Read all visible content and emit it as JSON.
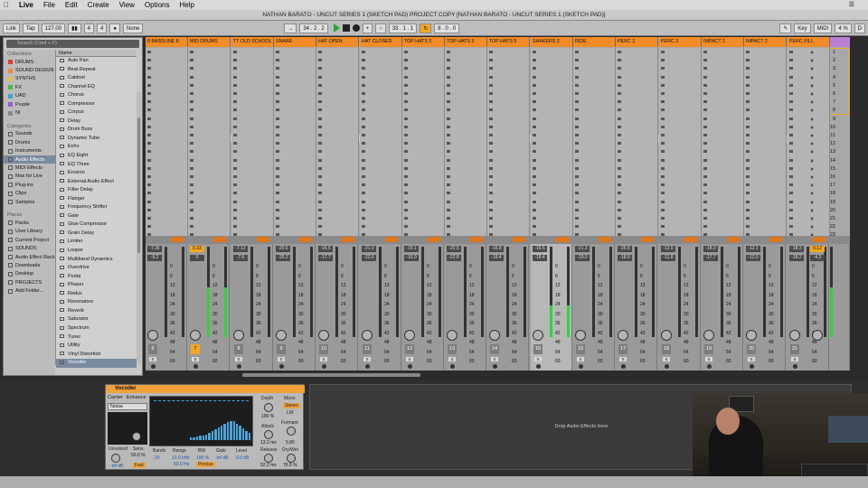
{
  "menubar": {
    "app": "Live",
    "items": [
      "File",
      "Edit",
      "Create",
      "View",
      "Options",
      "Help"
    ]
  },
  "titlebar": {
    "title": "NATHAN BARATO - UNCUT SERIES 1 (SKETCH PAD) PROJECT COPY  [NATHAN BARATO - UNCUT SERIES 1 (SKETCH PAD)]"
  },
  "transport": {
    "link": "Link",
    "tap": "Tap",
    "tempo": "127.00",
    "sig_num": "4",
    "sig_den": "4",
    "quantize": "None",
    "position": "34 .  2 .  2",
    "loop_start": "33 .  1 .  1",
    "loop_len": "8 .  0 .  0",
    "key": "Key",
    "midi": "MIDI",
    "cpu": "4 %",
    "disk": "D"
  },
  "browser": {
    "search_placeholder": "Search (Cmd + F)",
    "collections_label": "Collections",
    "collections": [
      {
        "label": "DRUMS",
        "color": "#e03b3b"
      },
      {
        "label": "SOUND DESIGN",
        "color": "#f08a2b"
      },
      {
        "label": "SYNTHS",
        "color": "#e6c23a"
      },
      {
        "label": "FX",
        "color": "#4fb54b"
      },
      {
        "label": "UAD",
        "color": "#3aa2c9"
      },
      {
        "label": "Purple",
        "color": "#9a5ad0"
      },
      {
        "label": "NI",
        "color": "#8a8a8a"
      }
    ],
    "categories_label": "Categories",
    "categories": [
      "Sounds",
      "Drums",
      "Instruments",
      "Audio Effects",
      "MIDI Effects",
      "Max for Live",
      "Plug-ins",
      "Clips",
      "Samples"
    ],
    "places_label": "Places",
    "places": [
      "Packs",
      "User Library",
      "Current Project",
      "SOUNDS",
      "Audio Effect Rack",
      "Downloads",
      "Desktop",
      "PROJECTS",
      "Add Folder..."
    ],
    "name_header": "Name",
    "items": [
      "Auto Pan",
      "Beat Repeat",
      "Cabinet",
      "Channel EQ",
      "Chorus",
      "Compressor",
      "Corpus",
      "Delay",
      "Drum Buss",
      "Dynamic Tube",
      "Echo",
      "EQ Eight",
      "EQ Three",
      "Erosion",
      "External Audio Effect",
      "Filter Delay",
      "Flanger",
      "Frequency Shifter",
      "Gate",
      "Glue Compressor",
      "Grain Delay",
      "Limiter",
      "Looper",
      "Multiband Dynamics",
      "Overdrive",
      "Pedal",
      "Phaser",
      "Redux",
      "Resonators",
      "Reverb",
      "Saturator",
      "Spectrum",
      "Tuner",
      "Utility",
      "Vinyl Distortion",
      "Vocoder"
    ]
  },
  "tracks": [
    {
      "name": "8 BASSLINE 8",
      "vol": "-7.36",
      "peak": "-9.2",
      "num": "6"
    },
    {
      "name": "MID DRUMS",
      "vol": "0.33",
      "peak": "0",
      "num": "7"
    },
    {
      "name": "TT OLD SCHOOL",
      "vol": "-7.12",
      "peak": "-7.6",
      "num": "8"
    },
    {
      "name": "SNARE",
      "vol": "-20.6",
      "peak": "-25.2",
      "num": "9"
    },
    {
      "name": "HAT OPEN",
      "vol": "-16.5",
      "peak": "-17.7",
      "num": "10"
    },
    {
      "name": "HAT CLOSED",
      "vol": "-21.0",
      "peak": "-22.6",
      "num": "11"
    },
    {
      "name": "TOP HATS 2",
      "vol": "-19.1",
      "peak": "-16.0",
      "num": "12"
    },
    {
      "name": "TOP HATS 3",
      "vol": "-22.5",
      "peak": "-22.8",
      "num": "13"
    },
    {
      "name": "TOP HATS 5",
      "vol": "-16.8",
      "peak": "-18.4",
      "num": "14"
    },
    {
      "name": "SHAKERS 2",
      "vol": "-16.5",
      "peak": "-18.4",
      "num": "15"
    },
    {
      "name": "RIDE",
      "vol": "-21.3",
      "peak": "-19.0",
      "num": "16"
    },
    {
      "name": "PERC 2",
      "vol": "-25.5",
      "peak": "-18.0",
      "num": "17"
    },
    {
      "name": "PERC 3",
      "vol": "-12.0",
      "peak": "-11.8",
      "num": "18"
    },
    {
      "name": "IMPACT 1",
      "vol": "-18.0",
      "peak": "-17.7",
      "num": "19"
    },
    {
      "name": "IMPACT 2",
      "vol": "-12.1",
      "peak": "-12.0",
      "num": "20"
    },
    {
      "name": "PERC FILL",
      "vol": "-18.3",
      "peak": "-18.2",
      "num": "21"
    }
  ],
  "master": {
    "name": "Master",
    "vol": "0.12",
    "peak": "-4.3",
    "scenes": [
      "1",
      "2",
      "3",
      "4",
      "5",
      "6",
      "7",
      "8",
      "9",
      "10",
      "11",
      "12",
      "13",
      "14",
      "15",
      "16",
      "17",
      "18",
      "19",
      "20",
      "21",
      "22",
      "23"
    ]
  },
  "meter_scale": [
    "0",
    "6",
    "12",
    "18",
    "24",
    "30",
    "36",
    "42",
    "48",
    "54",
    "60"
  ],
  "vocoder": {
    "title": "Vocoder",
    "tab_carrier": "Carrier",
    "tab_enhance": "Enhance",
    "carrier_value": "Noise",
    "depth_label": "Depth",
    "depth_value": "100 %",
    "mono_label": "Mono",
    "stereo_label": "Stereo",
    "lr_label": "L/R",
    "attack_label": "Attack",
    "attack_value": "13.2 ms",
    "formant_label": "Formant",
    "formant_value": "5.86",
    "release_label": "Release",
    "release_value": "52.2 ms",
    "drywet_label": "Dry/Wet",
    "drywet_value": "76.5 %",
    "unvoiced_label": "Unvoiced",
    "unvoiced_value": "-inf dB",
    "sens_label": "Sens.",
    "sens_value": "50.0 %",
    "fast_label": "Fast",
    "bands_label": "Bands",
    "bands_value": "20",
    "range_label": "Range",
    "range_hi": "12.0 kHz",
    "range_lo": "80.0 Hz",
    "bw_label": "BW",
    "bw_value": "100 %",
    "gate_label": "Gate",
    "gate_value": "-inf dB",
    "level_label": "Level",
    "level_value": "0.0 dB",
    "precise_label": "Precise",
    "spectrum": [
      0.1,
      0.12,
      0.15,
      0.18,
      0.2,
      0.25,
      0.3,
      0.38,
      0.45,
      0.55,
      0.62,
      0.7,
      0.78,
      0.82,
      0.8,
      0.7,
      0.6,
      0.5,
      0.4,
      0.3
    ]
  },
  "dropzone": {
    "text": "Drop Audio Effects Here"
  }
}
